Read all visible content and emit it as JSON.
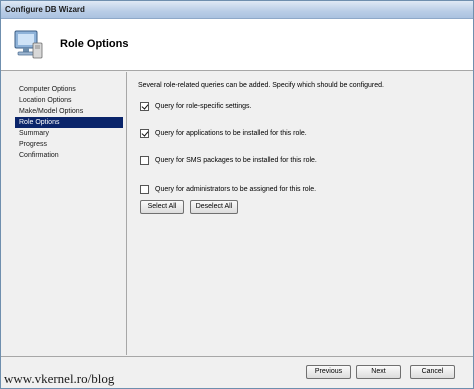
{
  "window": {
    "title": "Configure DB Wizard"
  },
  "header": {
    "title": "Role Options",
    "icon": "computer-icon"
  },
  "sidebar": {
    "items": [
      {
        "label": "Computer Options",
        "active": false
      },
      {
        "label": "Location Options",
        "active": false
      },
      {
        "label": "Make/Model Options",
        "active": false
      },
      {
        "label": "Role Options",
        "active": true
      },
      {
        "label": "Summary",
        "active": false
      },
      {
        "label": "Progress",
        "active": false
      },
      {
        "label": "Confirmation",
        "active": false
      }
    ]
  },
  "content": {
    "intro": "Several role-related queries can be added.  Specify which should be configured.",
    "options": [
      {
        "label": "Query for role-specific settings.",
        "checked": true
      },
      {
        "label": "Query for applications to be installed for this role.",
        "checked": true
      },
      {
        "label": "Query for SMS packages to be installed for this role.",
        "checked": false
      },
      {
        "label": "Query for administrators to be assigned for this role.",
        "checked": false
      }
    ],
    "select_all": "Select All",
    "deselect_all": "Deselect All"
  },
  "footer": {
    "previous": "Previous",
    "next": "Next",
    "cancel": "Cancel",
    "watermark": "www.vkernel.ro/blog"
  },
  "colors": {
    "selection": "#0a246a",
    "header_bg": "#ffffff",
    "panel_bg": "#f0f0f0"
  }
}
